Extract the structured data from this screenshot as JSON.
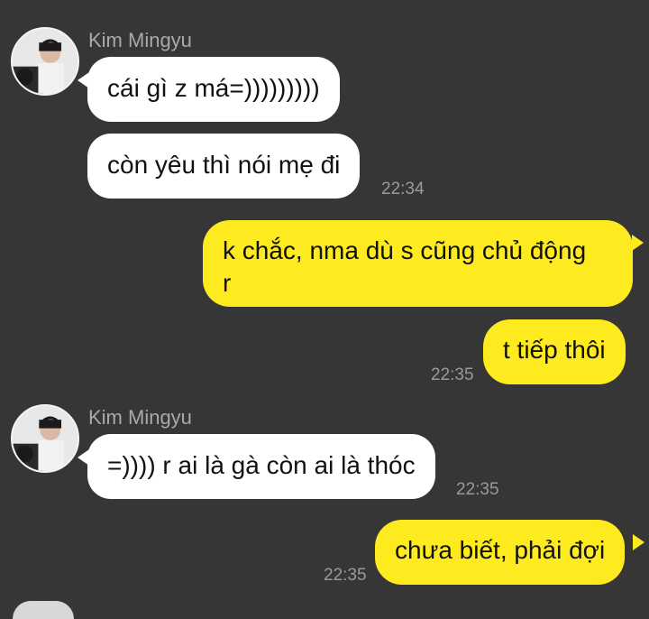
{
  "messages": [
    {
      "sender": "Kim Mingyu",
      "text": "cái gì z má=)))))))))"
    },
    {
      "text": "còn yêu thì nói mẹ đi",
      "time": "22:34"
    },
    {
      "text_line1": "k chắc, nma dù s cũng chủ động",
      "text_line2": "r"
    },
    {
      "text": "t tiếp thôi",
      "time": "22:35"
    },
    {
      "sender": "Kim Mingyu",
      "text": "=)))) r ai là gà còn ai là thóc",
      "time": "22:35"
    },
    {
      "text": "chưa biết, phải đợi",
      "time": "22:35"
    }
  ],
  "colors": {
    "background": "#363636",
    "incoming_bubble": "#ffffff",
    "outgoing_bubble": "#fdeb1f",
    "sender_name": "#a9a9a9",
    "timestamp": "#9a9a9a"
  },
  "icons": {
    "avatar": "avatar-photo"
  }
}
